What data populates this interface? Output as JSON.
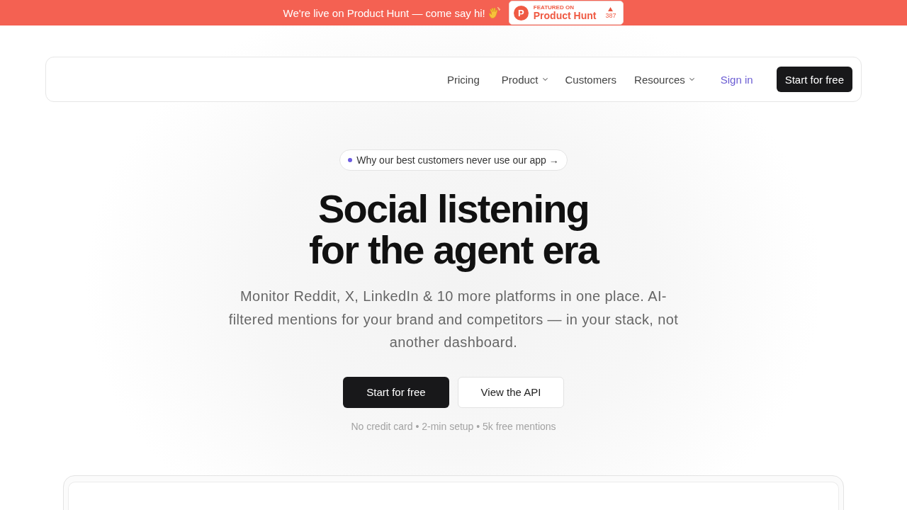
{
  "announcement_bar": {
    "text": "We're live on Product Hunt — come say hi!",
    "badge": {
      "logo_letter": "P",
      "eyebrow": "FEATURED ON",
      "name": "Product Hunt",
      "upvotes": "387"
    }
  },
  "navbar": {
    "links": [
      {
        "label": "Pricing",
        "has_menu": false
      },
      {
        "label": "Product",
        "has_menu": true
      },
      {
        "label": "Customers",
        "has_menu": false
      },
      {
        "label": "Resources",
        "has_menu": true
      }
    ],
    "sign_in": "Sign in",
    "cta": "Start for free"
  },
  "hero": {
    "pill": "Why our best customers never use our app →",
    "title_lines": [
      "Social listening",
      "for the agent era"
    ],
    "subtitle": "Monitor Reddit, X, LinkedIn & 10 more platforms in one place. AI-filtered mentions for your brand and competitors — in your stack, not another dashboard.",
    "buttons": [
      {
        "label": "Start for free",
        "kind": "primary"
      },
      {
        "label": "View the API",
        "kind": "secondary"
      }
    ],
    "note": "No credit card • 2-min setup • 5k free mentions"
  }
}
